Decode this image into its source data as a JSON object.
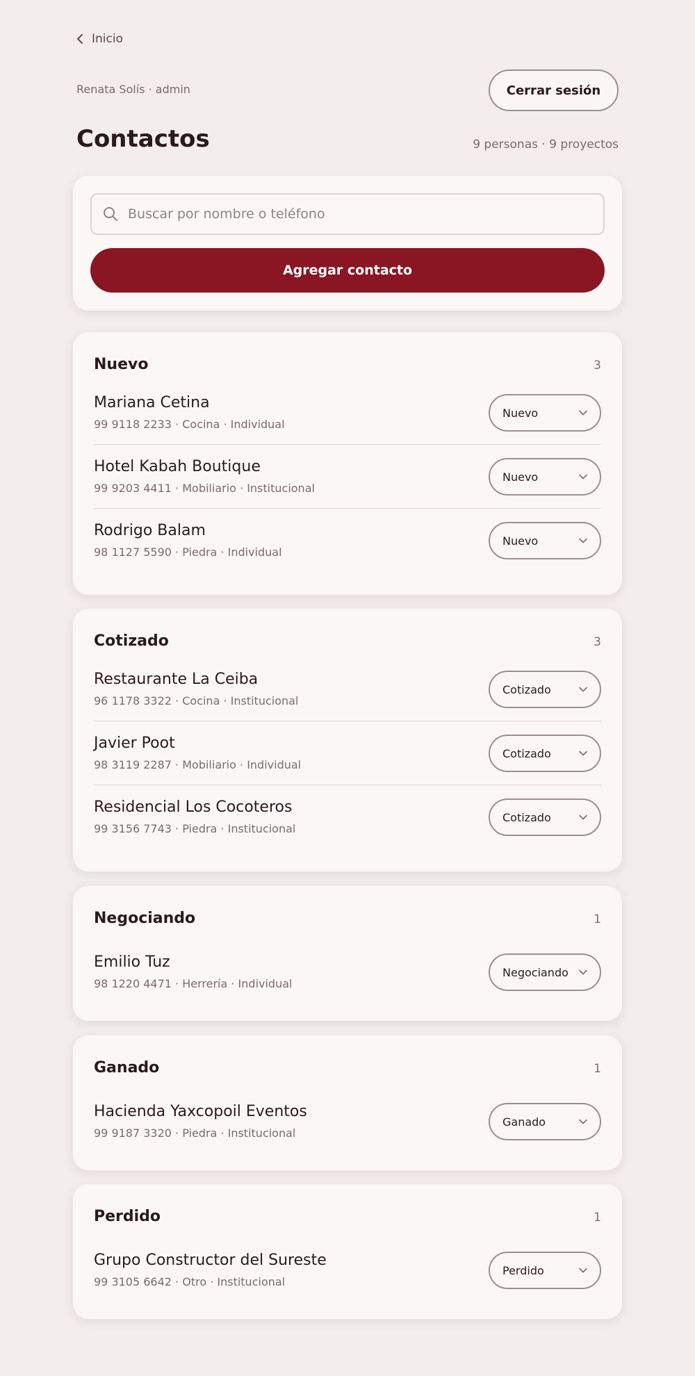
{
  "nav": {
    "back_label": "Inicio"
  },
  "session": {
    "user_line": "Renata Solís · admin",
    "logout_label": "Cerrar sesión"
  },
  "header": {
    "title": "Contactos",
    "summary": "9 personas · 9 proyectos"
  },
  "search": {
    "placeholder": "Buscar por nombre o teléfono",
    "value": ""
  },
  "actions": {
    "add_label": "Agregar contacto"
  },
  "colors": {
    "accent": "#8a1623",
    "background": "#f3eded",
    "card": "#fcf7f7"
  },
  "groups": [
    {
      "title": "Nuevo",
      "count": "3",
      "contacts": [
        {
          "name": "Mariana Cetina",
          "meta": "99 9118 2233 · Cocina · Individual",
          "status": "Nuevo"
        },
        {
          "name": "Hotel Kabah Boutique",
          "meta": "99 9203 4411 · Mobiliario · Institucional",
          "status": "Nuevo"
        },
        {
          "name": "Rodrigo Balam",
          "meta": "98 1127 5590 · Piedra · Individual",
          "status": "Nuevo"
        }
      ]
    },
    {
      "title": "Cotizado",
      "count": "3",
      "contacts": [
        {
          "name": "Restaurante La Ceiba",
          "meta": "96 1178 3322 · Cocina · Institucional",
          "status": "Cotizado"
        },
        {
          "name": "Javier Poot",
          "meta": "98 3119 2287 · Mobiliario · Individual",
          "status": "Cotizado"
        },
        {
          "name": "Residencial Los Cocoteros",
          "meta": "99 3156 7743 · Piedra · Institucional",
          "status": "Cotizado"
        }
      ]
    },
    {
      "title": "Negociando",
      "count": "1",
      "contacts": [
        {
          "name": "Emilio Tuz",
          "meta": "98 1220 4471 · Herrería · Individual",
          "status": "Negociando"
        }
      ]
    },
    {
      "title": "Ganado",
      "count": "1",
      "contacts": [
        {
          "name": "Hacienda Yaxcopoil Eventos",
          "meta": "99 9187 3320 · Piedra · Institucional",
          "status": "Ganado"
        }
      ]
    },
    {
      "title": "Perdido",
      "count": "1",
      "contacts": [
        {
          "name": "Grupo Constructor del Sureste",
          "meta": "99 3105 6642 · Otro · Institucional",
          "status": "Perdido"
        }
      ]
    }
  ]
}
